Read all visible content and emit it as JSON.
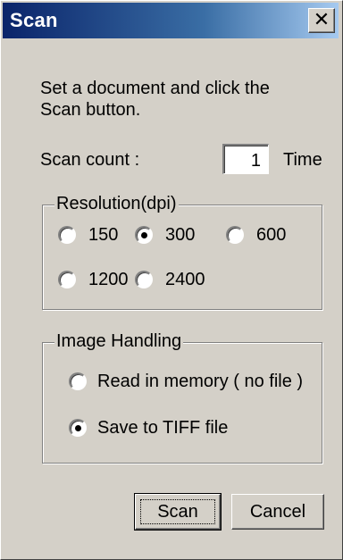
{
  "window": {
    "title": "Scan",
    "close_symbol": "✕"
  },
  "instructions": "Set a document and click the Scan button.",
  "scan_count": {
    "label": "Scan count :",
    "value": "1",
    "unit": "Time"
  },
  "resolution": {
    "legend": "Resolution(dpi)",
    "options": [
      {
        "label": "150",
        "selected": false
      },
      {
        "label": "300",
        "selected": true
      },
      {
        "label": "600",
        "selected": false
      },
      {
        "label": "1200",
        "selected": false
      },
      {
        "label": "2400",
        "selected": false
      }
    ]
  },
  "image_handling": {
    "legend": "Image Handling",
    "options": [
      {
        "label": "Read in memory ( no file )",
        "selected": false
      },
      {
        "label": "Save to TIFF file",
        "selected": true
      }
    ]
  },
  "buttons": {
    "scan_label": "Scan",
    "cancel_label": "Cancel"
  },
  "colors": {
    "face": "#d4d0c8",
    "title_start": "#0a246a",
    "title_end": "#a6caf0"
  }
}
